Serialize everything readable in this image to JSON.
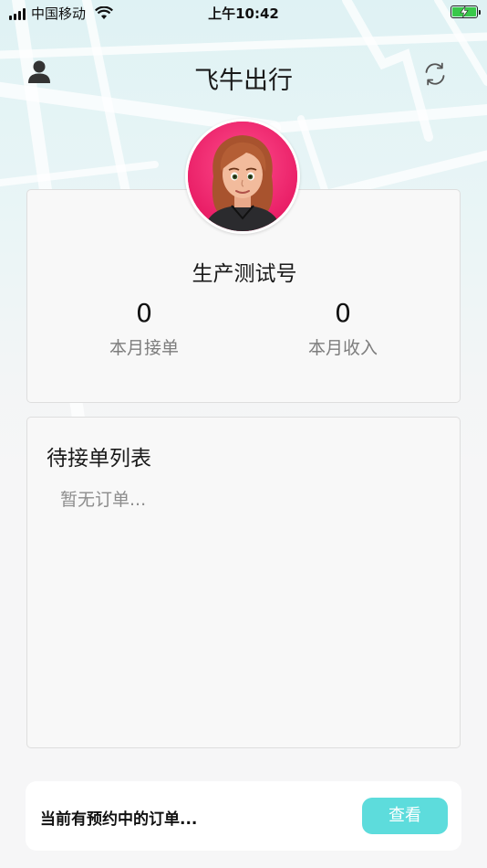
{
  "status_bar": {
    "carrier": "中国移动",
    "time": "上午10:42",
    "battery_color": "#39c84a"
  },
  "header": {
    "title": "飞牛出行",
    "left_icon": "user-icon",
    "right_icon": "refresh-icon"
  },
  "profile": {
    "avatar": "avatar-image",
    "nickname": "生产测试号",
    "stats": [
      {
        "value": "0",
        "label": "本月接单"
      },
      {
        "value": "0",
        "label": "本月收入"
      }
    ]
  },
  "pending_list": {
    "title": "待接单列表",
    "empty_text": "暂无订单..."
  },
  "reservation_bar": {
    "text": "当前有预约中的订单...",
    "button_label": "查看",
    "button_color": "#5ddcdc"
  }
}
